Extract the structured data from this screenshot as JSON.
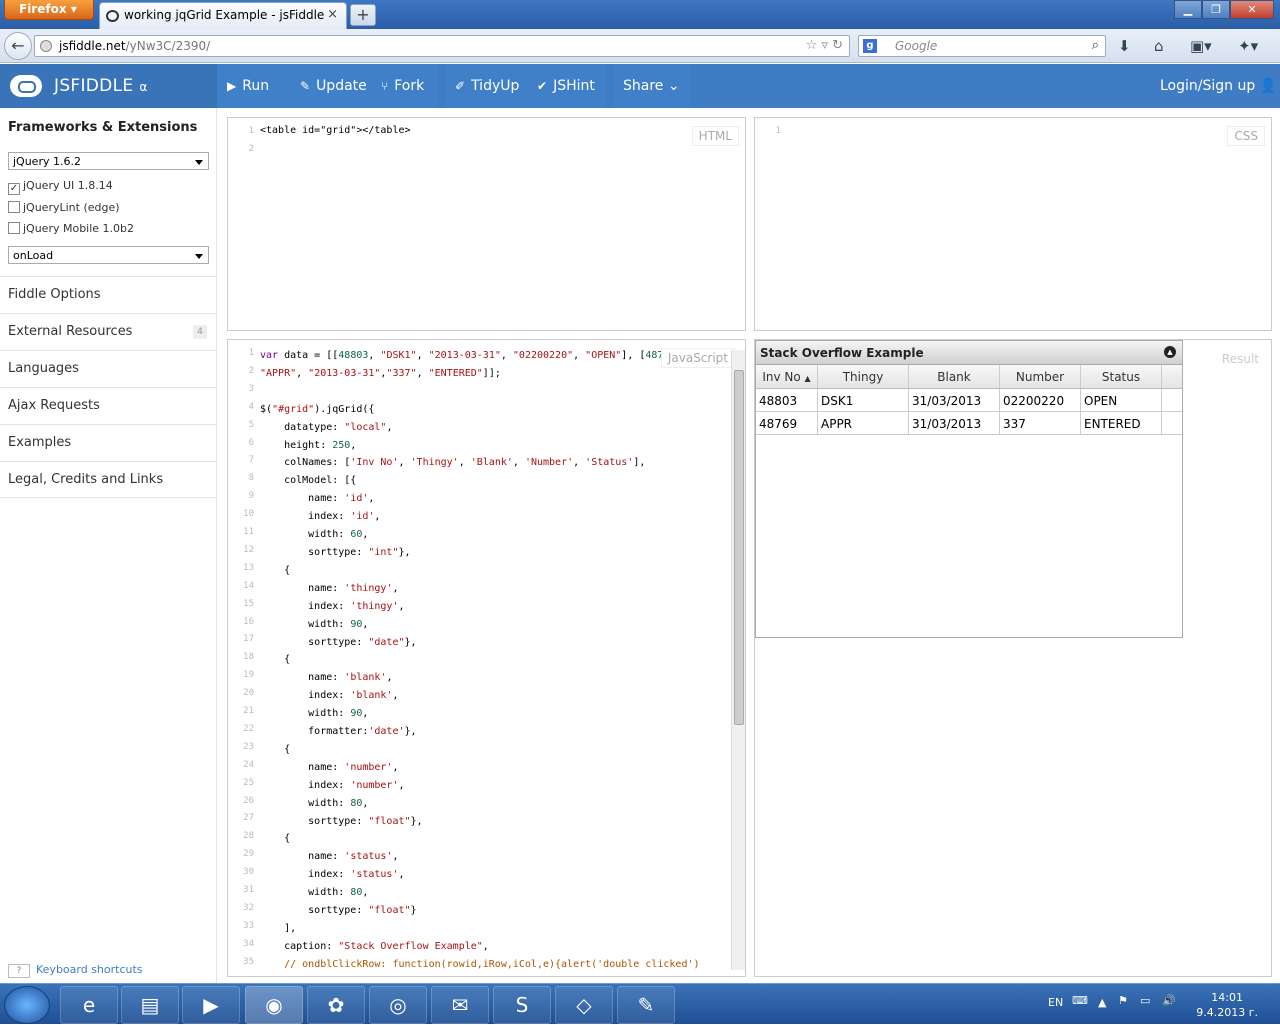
{
  "browser": {
    "menu_label": "Firefox",
    "tab_title": "working jqGrid Example - jsFiddle",
    "new_tab": "+",
    "url_host": "jsfiddle.net",
    "url_path": "/yNw3C/2390/",
    "search_placeholder": "Google"
  },
  "header": {
    "logo": "JSFIDDLE",
    "logo_suffix": "α",
    "buttons": [
      "Run",
      "Update",
      "Fork",
      "TidyUp",
      "JSHint",
      "Share"
    ],
    "login": "Login/Sign up"
  },
  "sidebar": {
    "title": "Frameworks & Extensions",
    "framework": "jQuery 1.6.2",
    "extensions": [
      {
        "label": "jQuery UI 1.8.14",
        "checked": true
      },
      {
        "label": "jQueryLint (edge)",
        "checked": false
      },
      {
        "label": "jQuery Mobile 1.0b2",
        "checked": false
      }
    ],
    "load": "onLoad",
    "items": [
      {
        "label": "Fiddle Options",
        "badge": ""
      },
      {
        "label": "External Resources",
        "badge": "4"
      },
      {
        "label": "Languages",
        "badge": ""
      },
      {
        "label": "Ajax Requests",
        "badge": ""
      },
      {
        "label": "Examples",
        "badge": ""
      },
      {
        "label": "Legal, Credits and Links",
        "badge": ""
      }
    ],
    "keyboard_hint": "?",
    "keyboard_label": "Keyboard shortcuts"
  },
  "panels": {
    "html_label": "HTML",
    "css_label": "CSS",
    "js_label": "JavaScript",
    "result_label": "Result"
  },
  "html_code": "<table id=\"grid\"></table>",
  "grid": {
    "caption": "Stack Overflow Example",
    "columns": [
      "Inv No",
      "Thingy",
      "Blank",
      "Number",
      "Status"
    ],
    "rows": [
      [
        "48803",
        "DSK1",
        "31/03/2013",
        "02200220",
        "OPEN"
      ],
      [
        "48769",
        "APPR",
        "31/03/2013",
        "337",
        "ENTERED"
      ]
    ]
  },
  "taskbar": {
    "lang": "EN",
    "time": "14:01",
    "date": "9.4.2013 г."
  }
}
